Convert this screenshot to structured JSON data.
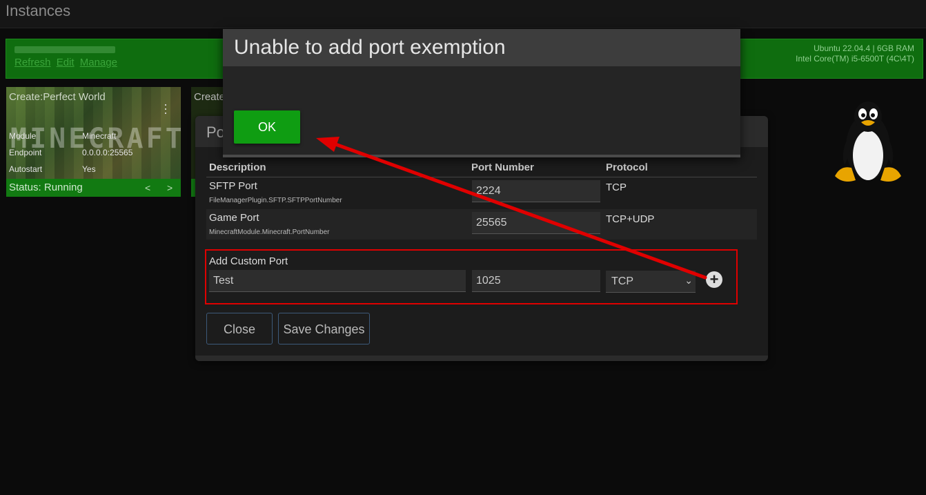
{
  "page": {
    "title": "Instances"
  },
  "server": {
    "links": [
      "Refresh",
      "Edit",
      "Manage"
    ],
    "os": "Ubuntu 22.04.4 | 6GB RAM",
    "cpu": "Intel Core(TM) i5-6500T (4C\\4T)",
    "color": "#0f6d0f"
  },
  "instance": {
    "title": "Create:Perfect World",
    "art_text": "MINECRAFT",
    "module_label": "Module",
    "module_value": "Minecraft",
    "endpoint_label": "Endpoint",
    "endpoint_value": "0.0.0.0:25565",
    "autostart_label": "Autostart",
    "autostart_value": "Yes",
    "status": "Status: Running",
    "prev": "<",
    "next": ">"
  },
  "instance2": {
    "title": "Create"
  },
  "port_panel": {
    "title": "Po",
    "columns": {
      "description": "Description",
      "port": "Port Number",
      "protocol": "Protocol"
    },
    "rows": [
      {
        "description": "SFTP Port",
        "key": "FileManagerPlugin.SFTP.SFTPPortNumber",
        "port": "2224",
        "protocol": "TCP"
      },
      {
        "description": "Game Port",
        "key": "MinecraftModule.Minecraft.PortNumber",
        "port": "25565",
        "protocol": "TCP+UDP"
      }
    ],
    "custom": {
      "label": "Add Custom Port",
      "name": "Test",
      "port": "1025",
      "protocol": "TCP",
      "add_icon": "plus-circle-icon"
    },
    "close_label": "Close",
    "save_label": "Save Changes"
  },
  "dialog": {
    "title": "Unable to add port exemption",
    "ok_label": "OK",
    "ok_color": "#0f9d12"
  },
  "annotation": {
    "highlight_color": "#e00000"
  }
}
